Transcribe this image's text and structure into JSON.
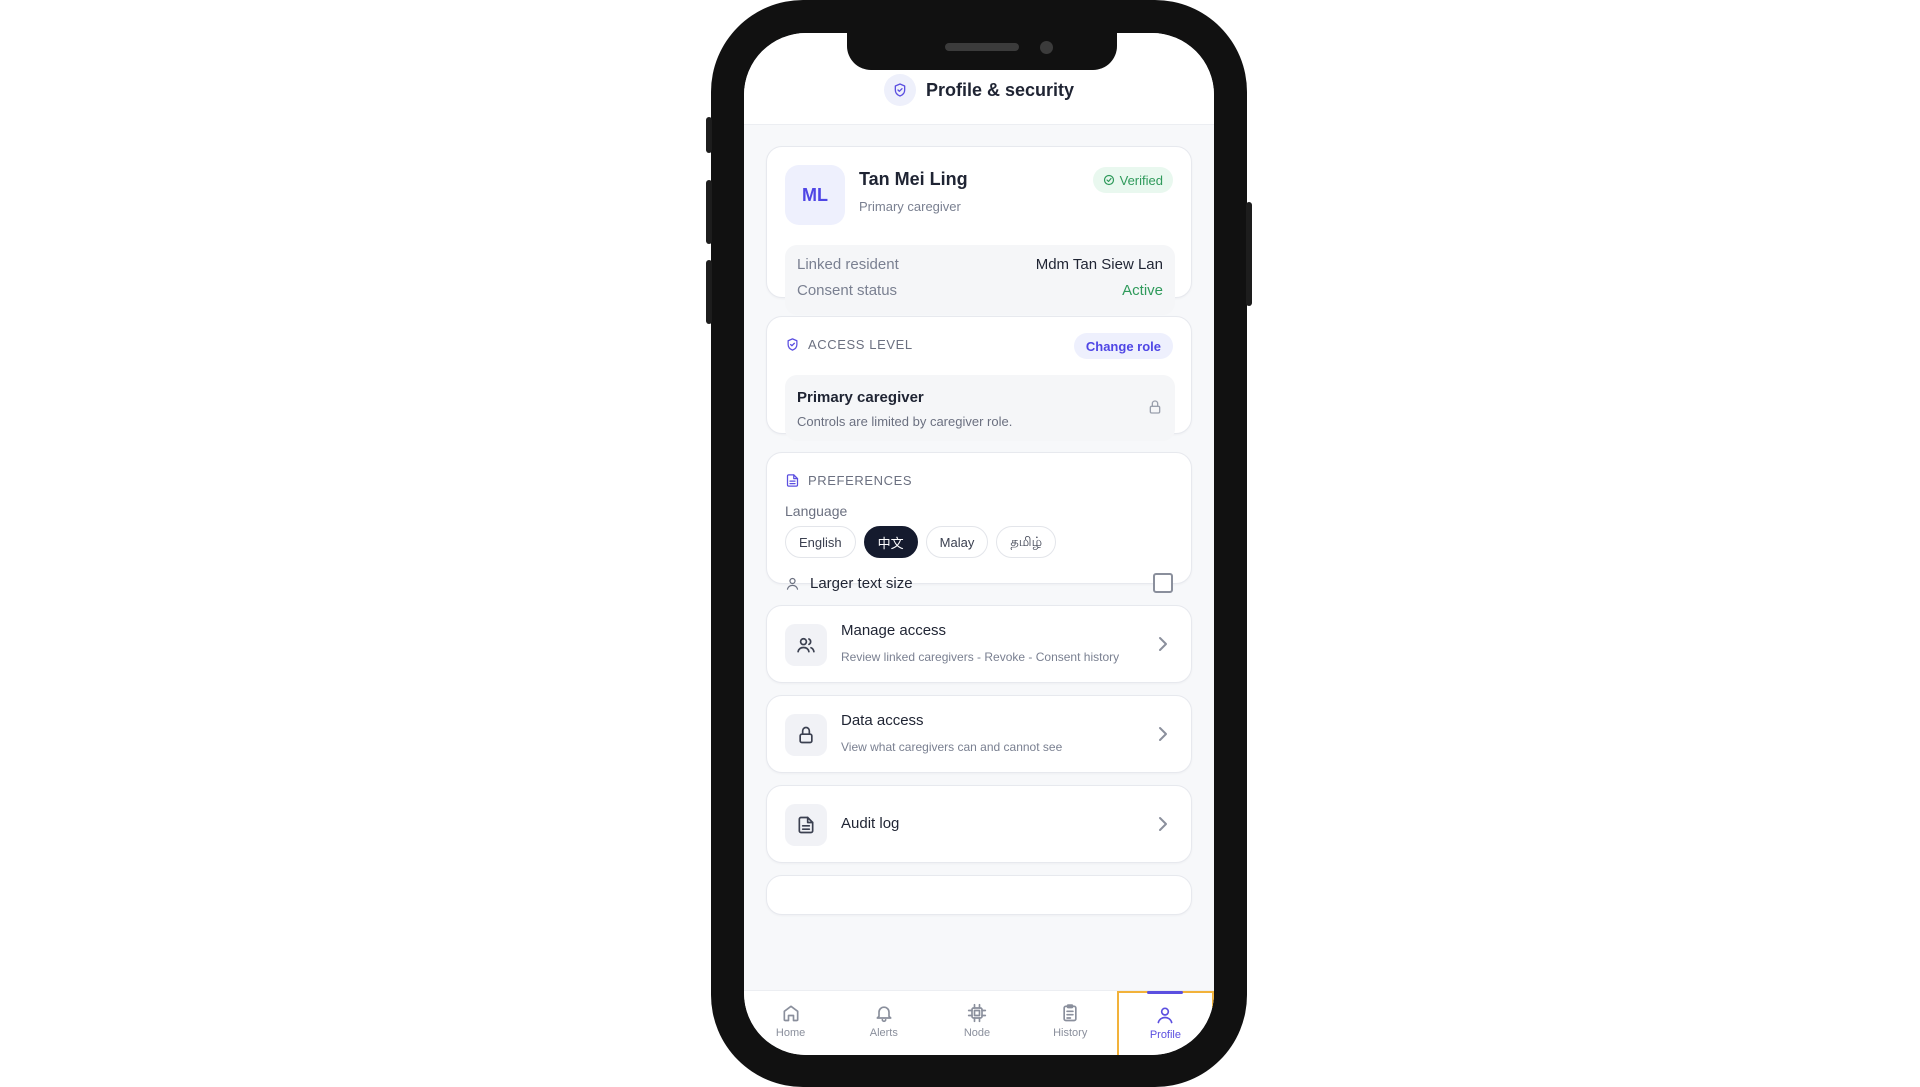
{
  "header": {
    "title": "Profile & security"
  },
  "profile": {
    "initials": "ML",
    "name": "Tan Mei Ling",
    "role": "Primary caregiver",
    "badge": "Verified",
    "linked_resident_label": "Linked resident",
    "linked_resident_value": "Mdm Tan Siew Lan",
    "consent_label": "Consent status",
    "consent_value": "Active"
  },
  "access": {
    "section_title": "ACCESS LEVEL",
    "change_button": "Change role",
    "role_title": "Primary caregiver",
    "role_desc": "Controls are limited by caregiver role."
  },
  "preferences": {
    "section_title": "PREFERENCES",
    "language_label": "Language",
    "languages": [
      "English",
      "中文",
      "Malay",
      "தமிழ்"
    ],
    "selected_language": "中文",
    "larger_text_label": "Larger text size",
    "larger_text_checked": false
  },
  "list": [
    {
      "title": "Manage access",
      "subtitle": "Review linked caregivers - Revoke - Consent history",
      "icon": "users-icon"
    },
    {
      "title": "Data access",
      "subtitle": "View what caregivers can and cannot see",
      "icon": "lock-icon"
    },
    {
      "title": "Audit log",
      "subtitle": "",
      "icon": "document-icon"
    }
  ],
  "nav": [
    {
      "label": "Home",
      "icon": "home-icon"
    },
    {
      "label": "Alerts",
      "icon": "bell-icon"
    },
    {
      "label": "Node",
      "icon": "chip-icon"
    },
    {
      "label": "History",
      "icon": "clipboard-icon"
    },
    {
      "label": "Profile",
      "icon": "user-icon",
      "active": true
    }
  ],
  "colors": {
    "accent": "#4f46e5",
    "success": "#2f9a5b",
    "highlight": "#f2b23a"
  }
}
